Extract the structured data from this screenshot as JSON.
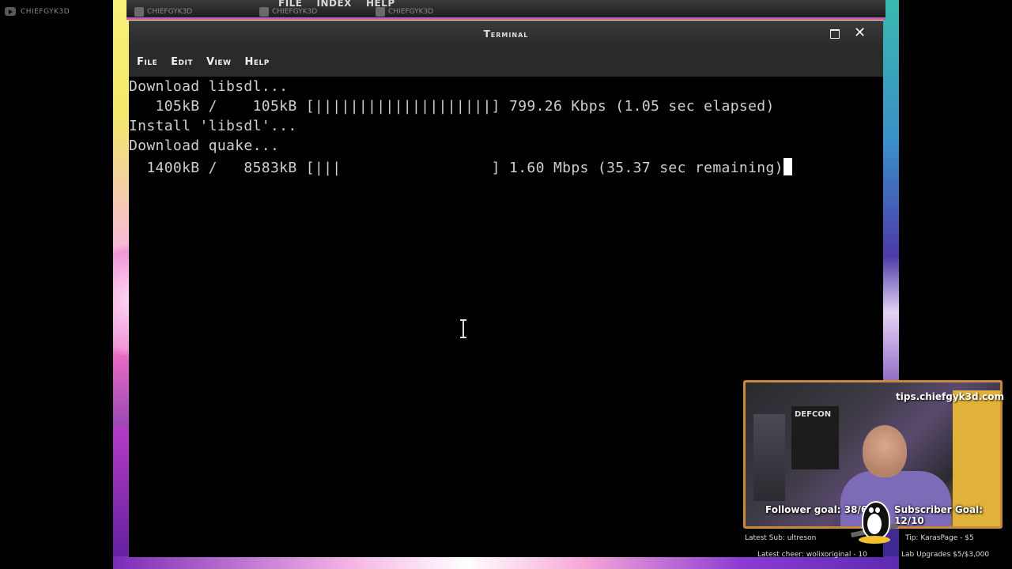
{
  "stream": {
    "left_badge": "CHIEFGYK3D",
    "social_1": "CHIEFGYK3D",
    "social_2": "CHIEFGYK3D",
    "social_3": "CHIEFGYK3D"
  },
  "background_window": {
    "menu": [
      "FILE",
      "INDEX",
      "HELP"
    ]
  },
  "terminal": {
    "title": "Terminal",
    "menu": [
      "File",
      "Edit",
      "View",
      "Help"
    ],
    "lines": [
      "Download libsdl...",
      "   105kB /    105kB [||||||||||||||||||||] 799.26 Kbps (1.05 sec elapsed)",
      "Install 'libsdl'...",
      "Download quake...",
      "  1400kB /   8583kB [|||                 ] 1.60 Mbps (35.37 sec remaining)"
    ]
  },
  "overlay": {
    "tips_url": "tips.chiefgyk3d.com",
    "poster_text": "DEFCON",
    "follower_goal": "Follower goal: 38/60",
    "subscriber_goal": "Subscriber Goal: 12/10",
    "latest_sub": "Latest Sub: ultreson",
    "tip": "Tip: KarasPage - $5",
    "latest_cheer": "Latest cheer: wolixoriginal - 10",
    "lab_upgrades": "Lab Upgrades $5/$3,000"
  }
}
